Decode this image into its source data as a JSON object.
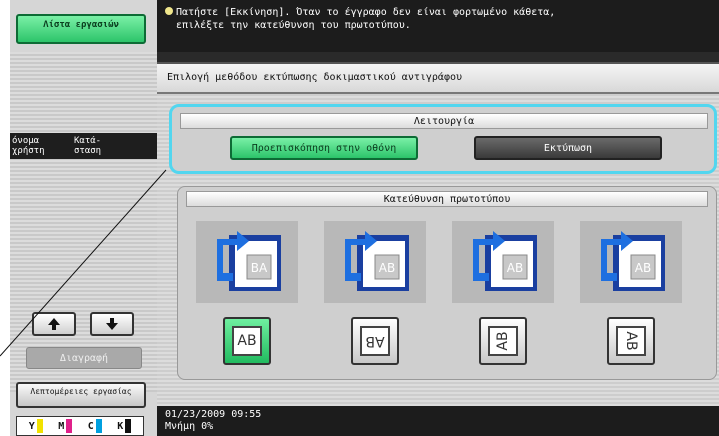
{
  "left_panel": {
    "job_list_label": "Λίστα εργασιών",
    "user_name_label": "όνομα χρήστη",
    "status_label": "Κατά- σταση",
    "delete_label": "Διαγραφή",
    "job_details_label": "Λεπτομέρειες εργασίας",
    "toner": [
      {
        "letter": "Y",
        "color": "#f2e200"
      },
      {
        "letter": "M",
        "color": "#e0208a"
      },
      {
        "letter": "C",
        "color": "#00a0e0"
      },
      {
        "letter": "K",
        "color": "#111111"
      }
    ]
  },
  "message": {
    "line1": "Πατήστε [Εκκίνηση]. Όταν το έγγραφο δεν είναι φορτωμένο κάθετα,",
    "line2": "επιλέξτε την κατεύθυνση του πρωτοτύπου."
  },
  "panel": {
    "title": "Επιλογή μεθόδου εκτύπωσης δοκιμαστικού αντιγράφου",
    "function_header": "Λειτουργία",
    "preview_label": "Προεπισκόπηση στην οθόνη",
    "print_label": "Εκτύπωση",
    "orientation_header": "Κατεύθυνση πρωτοτύπου",
    "orientation_options": [
      "AB",
      "AB",
      "AB",
      "AB"
    ]
  },
  "status": {
    "datetime": "01/23/2009    09:55",
    "memory": "Μνήμη        0%"
  },
  "colors": {
    "highlight": "#52d6ef",
    "active_green": "#2cc46a",
    "arrow_blue": "#1e6fe0"
  }
}
